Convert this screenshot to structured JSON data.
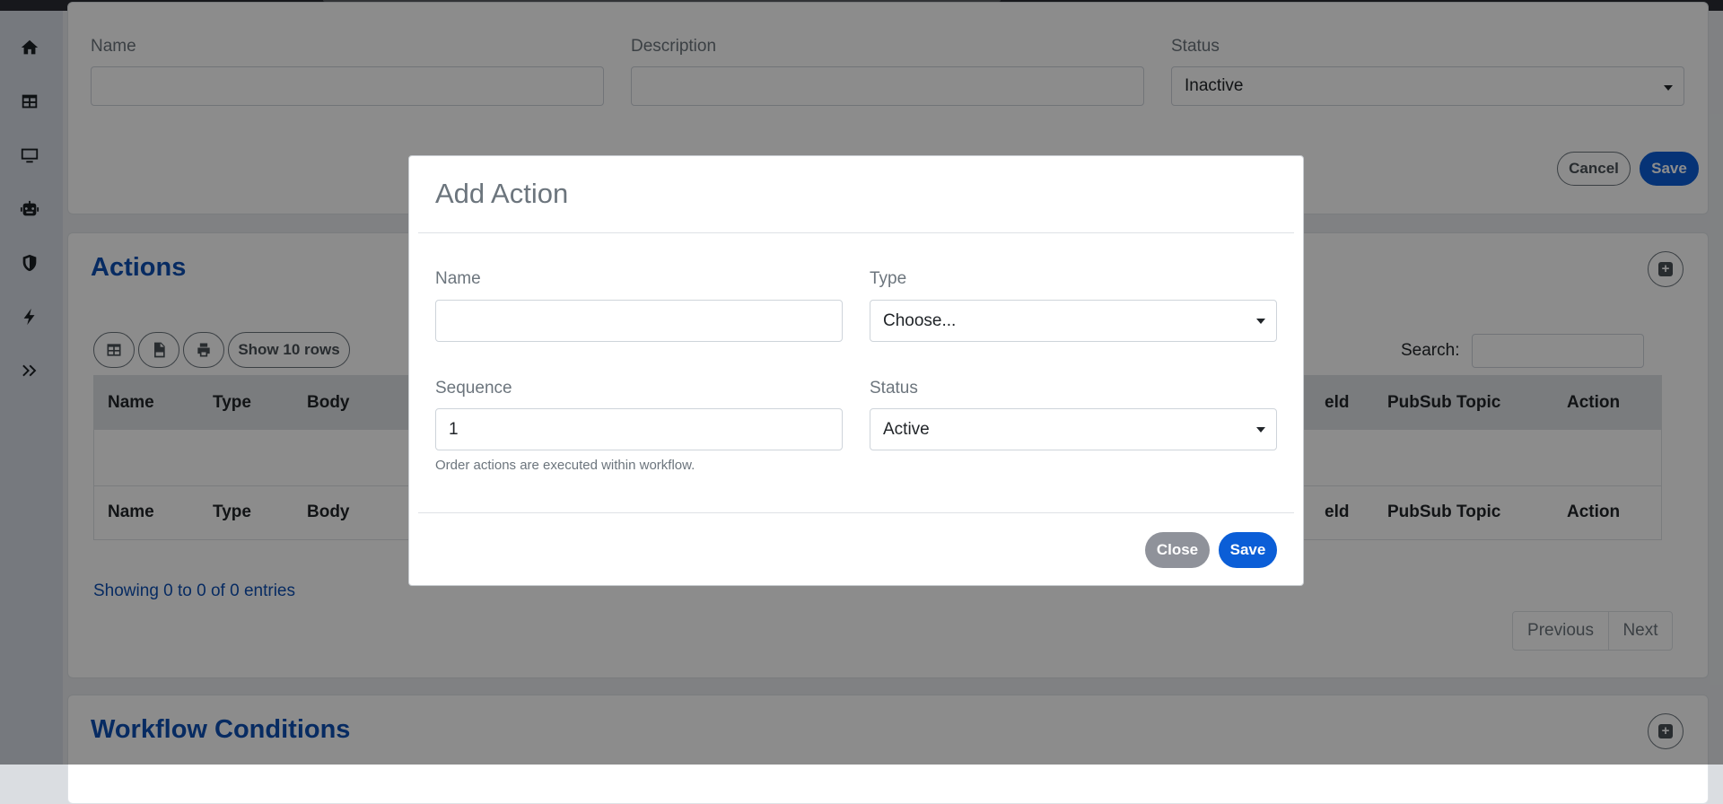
{
  "form": {
    "name_label": "Name",
    "name_value": "",
    "description_label": "Description",
    "description_value": "",
    "status_label": "Status",
    "status_value": "Inactive",
    "cancel_label": "Cancel",
    "save_label": "Save"
  },
  "actions": {
    "title": "Actions",
    "show_rows_label": "Show 10 rows",
    "search_label": "Search:",
    "search_value": "",
    "columns": [
      "Name",
      "Type",
      "Body",
      "eld",
      "PubSub Topic",
      "Action"
    ],
    "info": "Showing 0 to 0 of 0 entries",
    "previous_label": "Previous",
    "next_label": "Next"
  },
  "conditions": {
    "title": "Workflow Conditions"
  },
  "modal": {
    "title": "Add Action",
    "name_label": "Name",
    "name_value": "",
    "type_label": "Type",
    "type_value": "Choose...",
    "sequence_label": "Sequence",
    "sequence_value": "1",
    "sequence_help": "Order actions are executed within workflow.",
    "status_label": "Status",
    "status_value": "Active",
    "close_label": "Close",
    "save_label": "Save"
  },
  "icons": {
    "sidebar": [
      "home-icon",
      "table-icon",
      "monitor-icon",
      "robot-icon",
      "shield-icon",
      "bolt-icon",
      "double-chevron-right-icon"
    ]
  },
  "colors": {
    "primary": "#0b5ed7",
    "title_blue": "#0d4fb3",
    "secondary": "#8f929a"
  }
}
